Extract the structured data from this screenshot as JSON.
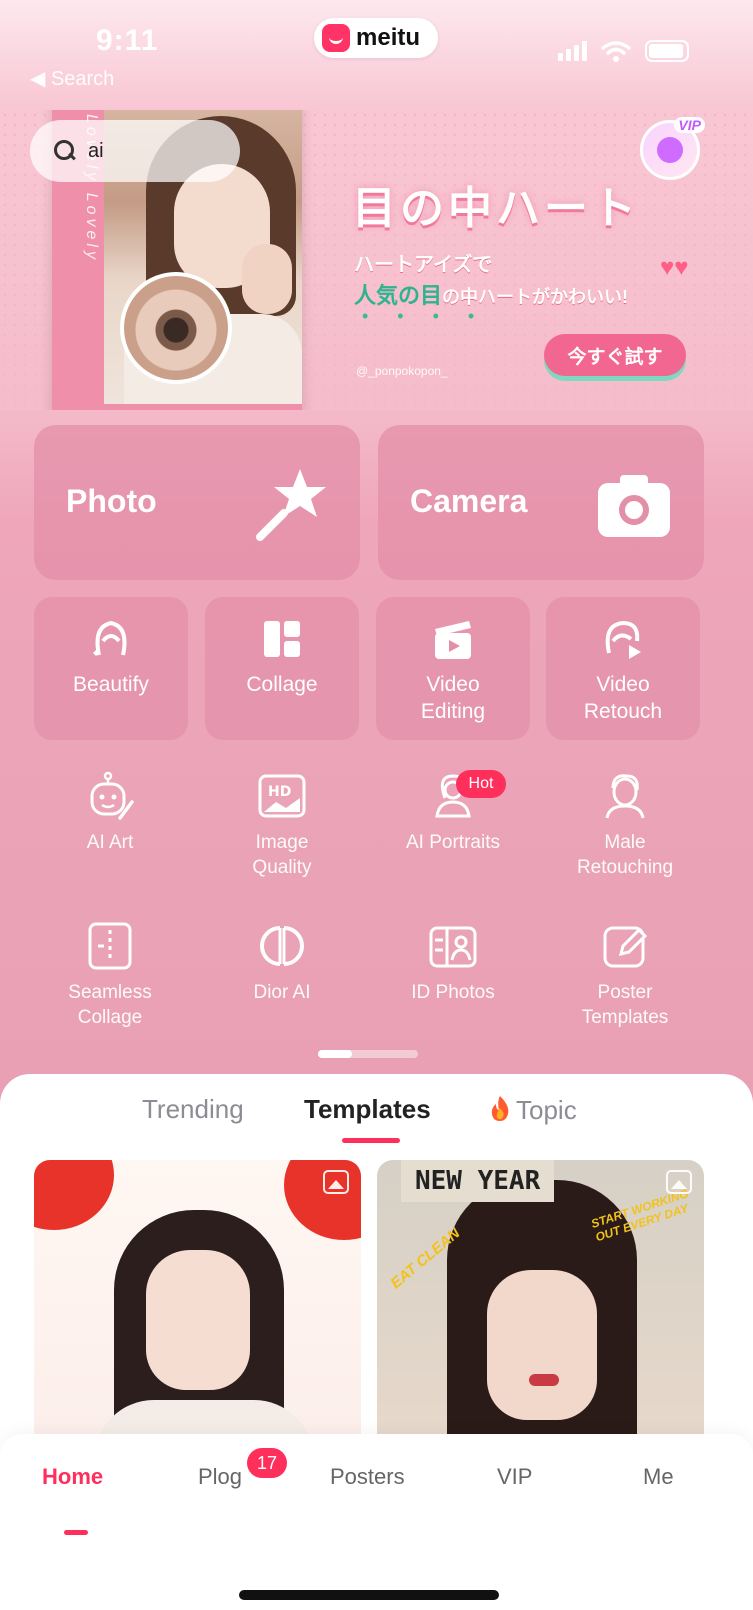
{
  "status_bar": {
    "time": "9:11",
    "back_label": "◀ Search",
    "app_logo_text": "meitu"
  },
  "search": {
    "query": "ai"
  },
  "banner": {
    "vertical_text": "Lovely Lovely",
    "vip_label": "VIP",
    "title": "目の中ハート",
    "subtitle_line1": "ハートアイズで",
    "subtitle_line2_colored": "人気の目",
    "subtitle_line2_rest": "の中ハートがかわいい!",
    "cta": "今すぐ試す",
    "credit": "@_ponpokopon_"
  },
  "main_actions": [
    {
      "label": "Photo",
      "icon": "magic-wand-icon"
    },
    {
      "label": "Camera",
      "icon": "camera-icon"
    }
  ],
  "quick_tools": [
    {
      "label": "Beautify",
      "icon": "beautify-icon"
    },
    {
      "label": "Collage",
      "icon": "collage-icon"
    },
    {
      "label": "Video\nEditing",
      "icon": "clapperboard-icon"
    },
    {
      "label": "Video\nRetouch",
      "icon": "video-retouch-icon"
    }
  ],
  "tools": [
    {
      "label": "AI Art",
      "icon": "robot-brush-icon"
    },
    {
      "label": "Image\nQuality",
      "icon": "hd-image-icon"
    },
    {
      "label": "AI Portraits",
      "icon": "portrait-icon",
      "badge": "Hot"
    },
    {
      "label": "Male\nRetouching",
      "icon": "male-face-icon"
    },
    {
      "label": "Seamless\nCollage",
      "icon": "seamless-collage-icon"
    },
    {
      "label": "Dior AI",
      "icon": "dior-logo-icon"
    },
    {
      "label": "ID Photos",
      "icon": "id-card-icon"
    },
    {
      "label": "Poster\nTemplates",
      "icon": "edit-poster-icon"
    }
  ],
  "content_tabs": {
    "items": [
      "Trending",
      "Templates",
      "Topic"
    ],
    "active": "Templates"
  },
  "cards": [
    {
      "type": "image",
      "label": ""
    },
    {
      "type": "image",
      "label": "NEW YEAR",
      "scribble1": "EAT CLEAN",
      "scribble2": "START WORKING OUT EVERY DAY"
    }
  ],
  "bottom_nav": {
    "items": [
      "Home",
      "Plog",
      "Posters",
      "VIP",
      "Me"
    ],
    "active": "Home",
    "plog_badge": "17"
  },
  "colors": {
    "accent": "#ff2f5b",
    "tile": "#e38fa8",
    "background": "#eba4b8"
  }
}
